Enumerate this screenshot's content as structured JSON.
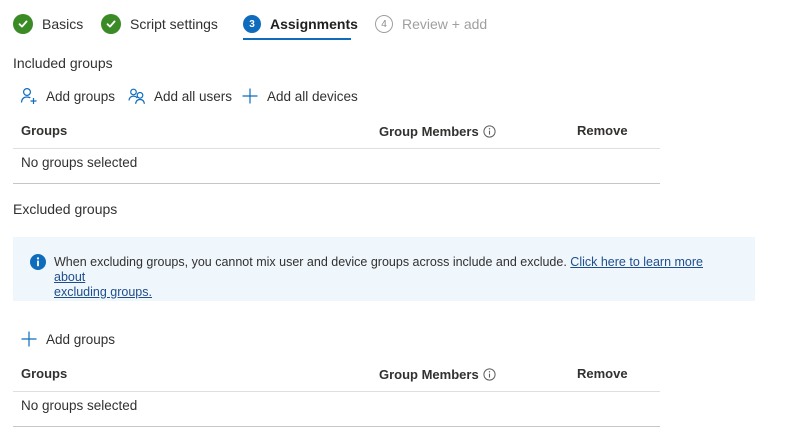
{
  "wizard": {
    "steps": [
      {
        "label": "Basics",
        "state": "done"
      },
      {
        "label": "Script settings",
        "state": "done"
      },
      {
        "label": "Assignments",
        "number": "3",
        "state": "current"
      },
      {
        "label": "Review + add",
        "number": "4",
        "state": "upcoming"
      }
    ]
  },
  "included": {
    "title": "Included groups",
    "actions": {
      "add_groups": "Add groups",
      "add_all_users": "Add all users",
      "add_all_devices": "Add all devices"
    },
    "table": {
      "columns": [
        "Groups",
        "Group Members",
        "Remove"
      ],
      "empty_text": "No groups selected"
    }
  },
  "excluded": {
    "title": "Excluded groups",
    "info": {
      "message": "When excluding groups, you cannot mix user and device groups across include and exclude.",
      "link_line1": "Click here to learn more about",
      "link_line2": "excluding groups."
    },
    "actions": {
      "add_groups": "Add groups"
    },
    "table": {
      "columns": [
        "Groups",
        "Group Members",
        "Remove"
      ],
      "empty_text": "No groups selected"
    }
  },
  "colors": {
    "accent": "#0f6cbd",
    "success": "#3a8a26",
    "info_bg": "#eff6fc",
    "link": "#1f4e8c"
  }
}
